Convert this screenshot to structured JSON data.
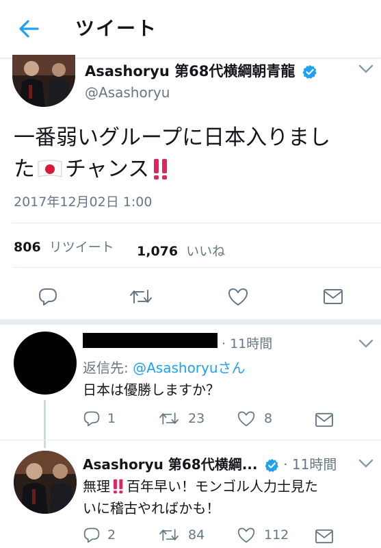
{
  "header": {
    "title": "ツイート"
  },
  "main_tweet": {
    "display_name": "Asashoryu 第68代横綱朝青龍",
    "handle": "@Asashoryu",
    "text_line1": "一番弱いグループに日本入りまし",
    "text_line2_pre": "た",
    "text_line2_mid": "チャンス",
    "timestamp": "2017年12月02日 1:00",
    "retweet_count": "806",
    "retweet_label": "リツイート",
    "like_count": "1,076",
    "like_label": "いいね"
  },
  "reply1": {
    "time": "· 11時間",
    "reply_to_prefix": "返信先: ",
    "reply_to_handle": "@Asashoryuさん",
    "text": "日本は優勝しますか？",
    "reply_count": "1",
    "retweet_count": "23",
    "like_count": "8"
  },
  "reply2": {
    "display_name": "Asashoryu 第68代横綱...",
    "time": "· 11時間",
    "text_pre": "無理",
    "text_post": "百年早い！モンゴル人力士見た",
    "text_line2": "いに稽古やればかも！",
    "reply_count": "2",
    "retweet_count": "84",
    "like_count": "112"
  },
  "colors": {
    "accent": "#1da1f2",
    "gray": "#657786",
    "red": "#e0245e"
  },
  "icons": [
    "back-arrow-icon",
    "verified-badge-icon",
    "chevron-down-icon",
    "japan-flag-icon",
    "double-exclamation-icon",
    "reply-icon",
    "retweet-icon",
    "like-icon",
    "share-icon"
  ]
}
